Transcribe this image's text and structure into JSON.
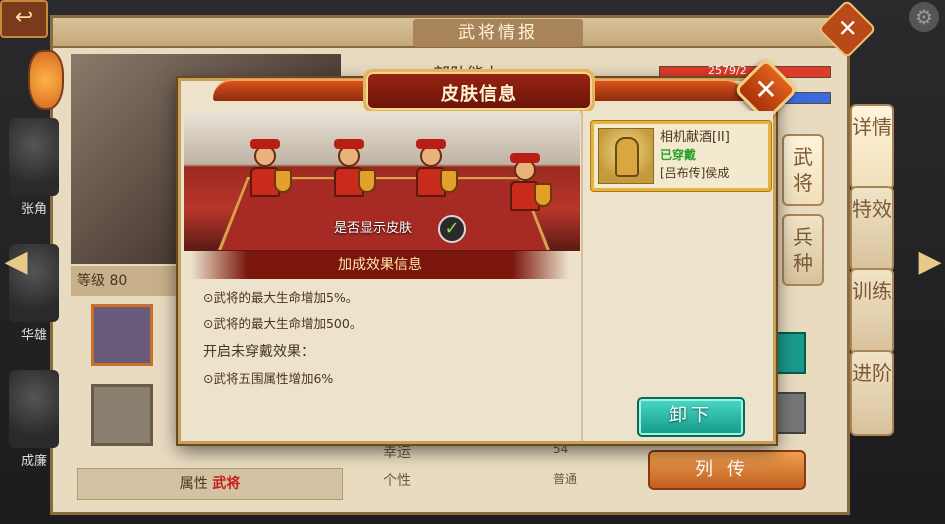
{
  "background": {
    "window_title": "武将情报",
    "troop_ability_label": "部队能力",
    "hp_value": "2579/2",
    "level_label": "等级 80",
    "attribute_label": "属性",
    "attribute_value": "武将",
    "luck_label": "幸运",
    "luck_value": "54",
    "personality_label": "个性",
    "personality_value": "普通",
    "biography_button": "列传",
    "left_heroes": [
      "张角",
      "华雄",
      "成廉"
    ],
    "right_tabs": [
      "详情",
      "武将",
      "兵种",
      "特效",
      "训练",
      "进阶"
    ],
    "close_icon": "close-icon",
    "colors": {
      "hp_bar": "#e03a2a",
      "mp_bar": "#3a6ae0"
    }
  },
  "modal": {
    "title": "皮肤信息",
    "show_skin_label": "是否显示皮肤",
    "show_skin_checked": true,
    "bonus_header": "加成效果信息",
    "effects": [
      "⊙武将的最大生命增加5%。",
      "⊙武将的最大生命增加500。"
    ],
    "unworn_header": "开启未穿戴效果：",
    "unworn_effects": [
      "⊙武将五围属性增加6%"
    ],
    "skin_card": {
      "name": "相机献酒[II]",
      "status": "已穿戴",
      "hero": "[吕布传]侯成"
    },
    "unequip_button": "卸下",
    "colors": {
      "banner": "#9a2412",
      "card_border": "#e6b43a",
      "button": "#1ea896",
      "equipped_text": "#2aa22a"
    }
  }
}
